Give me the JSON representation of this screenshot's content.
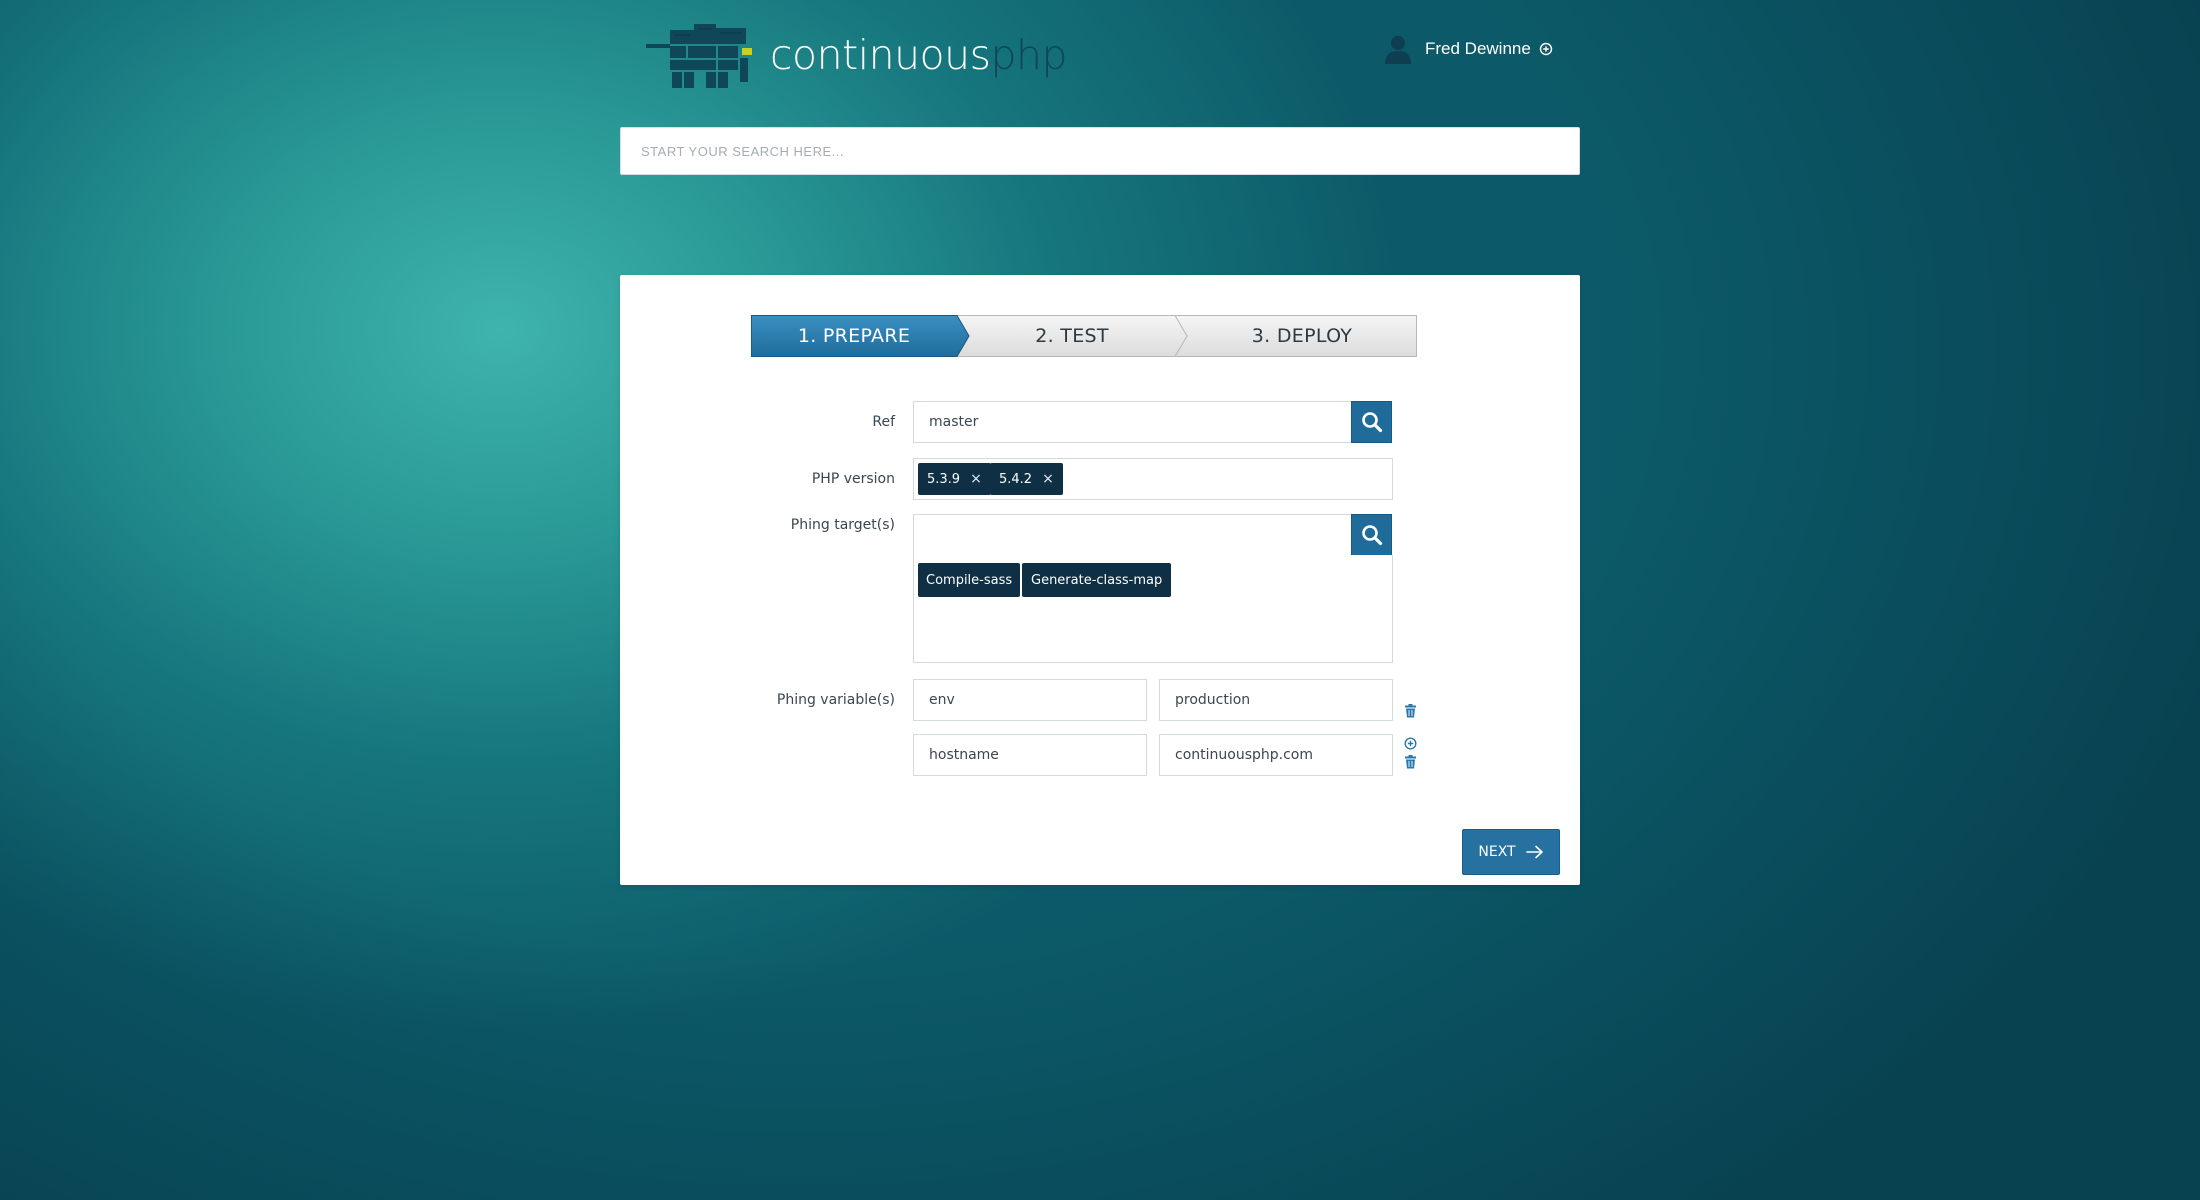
{
  "header": {
    "logo": {
      "text_main": "continuous",
      "text_accent": "php",
      "icon": "elephant-logo-icon"
    },
    "user": {
      "name": "Fred Dewinne",
      "icon": "user-icon",
      "menu_icon": "plus-circle-icon"
    }
  },
  "search": {
    "placeholder": "START YOUR SEARCH HERE...",
    "value": ""
  },
  "wizard": {
    "steps": [
      {
        "label": "1. PREPARE",
        "active": true
      },
      {
        "label": "2. TEST",
        "active": false
      },
      {
        "label": "3. DEPLOY",
        "active": false
      }
    ]
  },
  "form": {
    "ref": {
      "label": "Ref",
      "value": "master",
      "button_icon": "search-icon"
    },
    "php_version": {
      "label": "PHP version",
      "tags": [
        "5.3.9",
        "5.4.2"
      ],
      "remove_icon": "close-icon"
    },
    "phing_targets": {
      "label": "Phing target(s)",
      "value": "",
      "button_icon": "search-icon",
      "selected": [
        "Compile-sass",
        "Generate-class-map"
      ]
    },
    "phing_variables": {
      "label": "Phing variable(s)",
      "rows": [
        {
          "key": "env",
          "value": "production"
        },
        {
          "key": "hostname",
          "value": "continuousphp.com"
        }
      ],
      "add_icon": "plus-circle-icon",
      "delete_icon": "trash-icon"
    },
    "next_label": "NEXT",
    "next_icon": "arrow-right-icon"
  },
  "colors": {
    "background_light": "#3fb3ad",
    "background_dark": "#0c5a69",
    "primary": "#1f6c9b",
    "tag": "#0f2f45",
    "logo_accent": "#0f4658"
  }
}
